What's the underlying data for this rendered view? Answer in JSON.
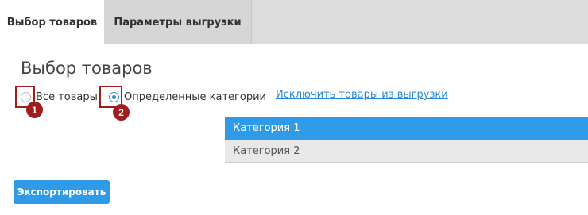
{
  "tabs": [
    {
      "label": "Выбор товаров",
      "active": true
    },
    {
      "label": "Параметры выгрузки",
      "active": false
    }
  ],
  "section": {
    "title": "Выбор товаров"
  },
  "radios": {
    "all_label": "Все товары",
    "all_checked": false,
    "specific_label": "Определенные категории",
    "specific_checked": true
  },
  "exclude_link": "Исключить товары из выгрузки",
  "categories": [
    {
      "label": "Категория 1",
      "selected": true
    },
    {
      "label": "Категория 2",
      "selected": false
    }
  ],
  "callouts": [
    "1",
    "2"
  ],
  "export_button": "Экспортировать",
  "colors": {
    "accent": "#2f9be8",
    "callout": "#a11d1d",
    "tabbar": "#dcdcdc"
  }
}
